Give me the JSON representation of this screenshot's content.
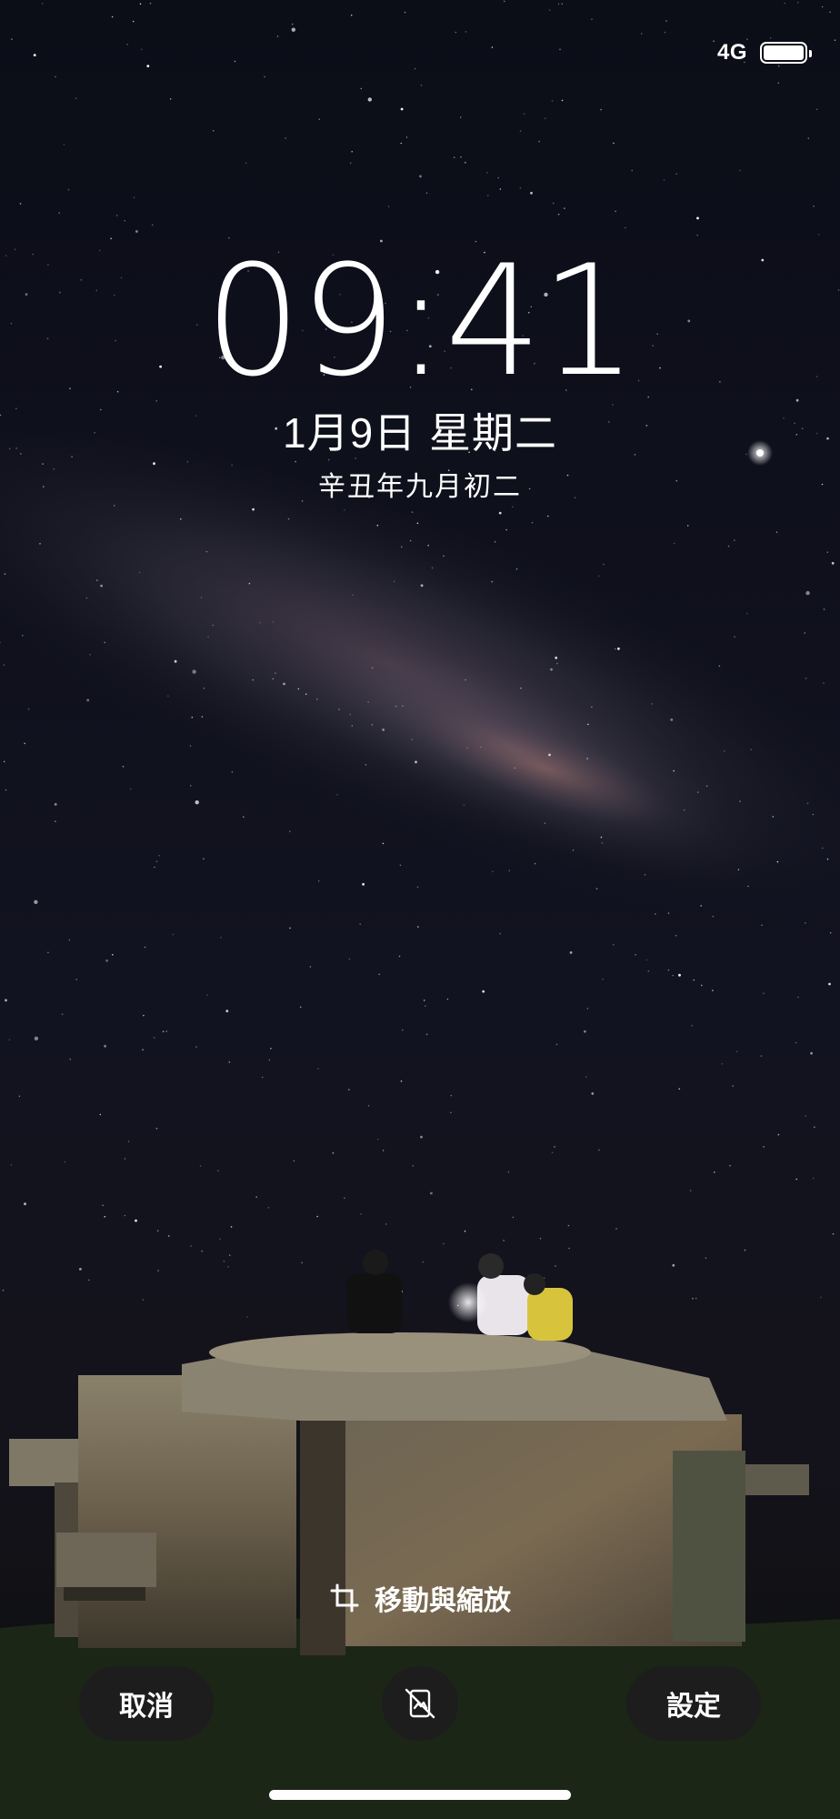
{
  "status_bar": {
    "network": "4G",
    "battery_level": 1.0,
    "battery_icon": "battery-icon"
  },
  "lock_screen": {
    "time": "09:41",
    "date": "1月9日 星期二",
    "lunar_date": "辛丑年九月初二"
  },
  "editor": {
    "hint_icon": "crop-icon",
    "hint_text": "移動與縮放",
    "cancel_label": "取消",
    "toggle_icon": "depth-effect-off-icon",
    "set_label": "設定"
  },
  "colors": {
    "sky_top": "#0b0d17",
    "sky_bottom": "#14131b",
    "milky_way_glow": "#6c5a6a",
    "bunker": "#6e6350",
    "grass": "#27351f",
    "button_bg": "#1c1c1e"
  }
}
